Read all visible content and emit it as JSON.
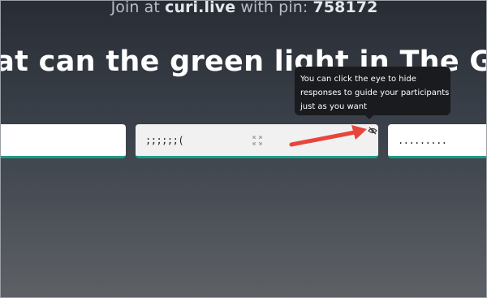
{
  "header": {
    "join_prefix": "Join at ",
    "join_site": "curi.live",
    "join_middle": " with pin: ",
    "join_pin": "758172"
  },
  "question": {
    "text": "hat can the green light in The Gr"
  },
  "responses": [
    {
      "text": ""
    },
    {
      "text": ";;;;;;("
    },
    {
      "text": "........."
    }
  ],
  "tooltip": {
    "lines": [
      "You can click the eye to hide",
      "responses to guide your participants",
      "just as you want"
    ]
  },
  "icons": {
    "expand": "expand-icon",
    "eye": "eye-slash-icon"
  },
  "colors": {
    "card_accent": "#1f9c86",
    "annotation_arrow": "#e8453c",
    "tooltip_bg": "#191b1e"
  }
}
